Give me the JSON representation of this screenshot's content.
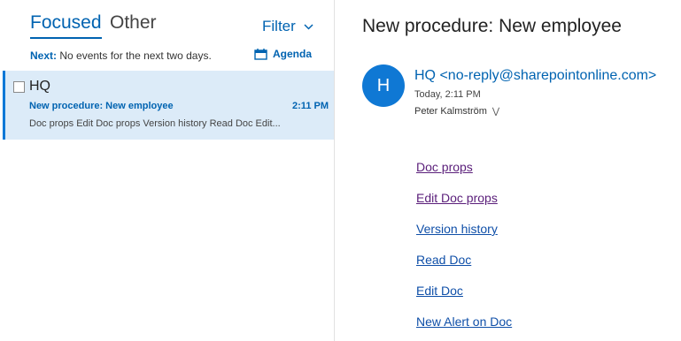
{
  "tabs": {
    "focused": "Focused",
    "other": "Other"
  },
  "filter": {
    "label": "Filter"
  },
  "agenda": {
    "next_label": "Next:",
    "next_text": "No events for the next two days.",
    "button_label": "Agenda"
  },
  "message": {
    "sender": "HQ",
    "subject": "New procedure: New employee",
    "time": "2:11 PM",
    "preview": "Doc props Edit Doc props Version history Read Doc Edit..."
  },
  "reading_pane": {
    "title": "New procedure: New employee",
    "avatar_initial": "H",
    "from": "HQ <no-reply@sharepointonline.com>",
    "sent_time": "Today, 2:11 PM",
    "recipient": "Peter Kalmström",
    "links": [
      "Doc props",
      "Edit Doc props",
      "Version history",
      "Read Doc",
      "Edit Doc",
      "New Alert on Doc"
    ]
  },
  "colors": {
    "accent": "#0063b1",
    "selected_bg": "#dcebf8",
    "avatar_bg": "#0f78d4",
    "visited_link": "#5a1e7a",
    "link": "#0f4fa8"
  },
  "icons": {
    "filter_chevron": "chevron-down-icon",
    "agenda": "calendar-icon",
    "expand_recipients": "double-chevron-down-icon"
  }
}
